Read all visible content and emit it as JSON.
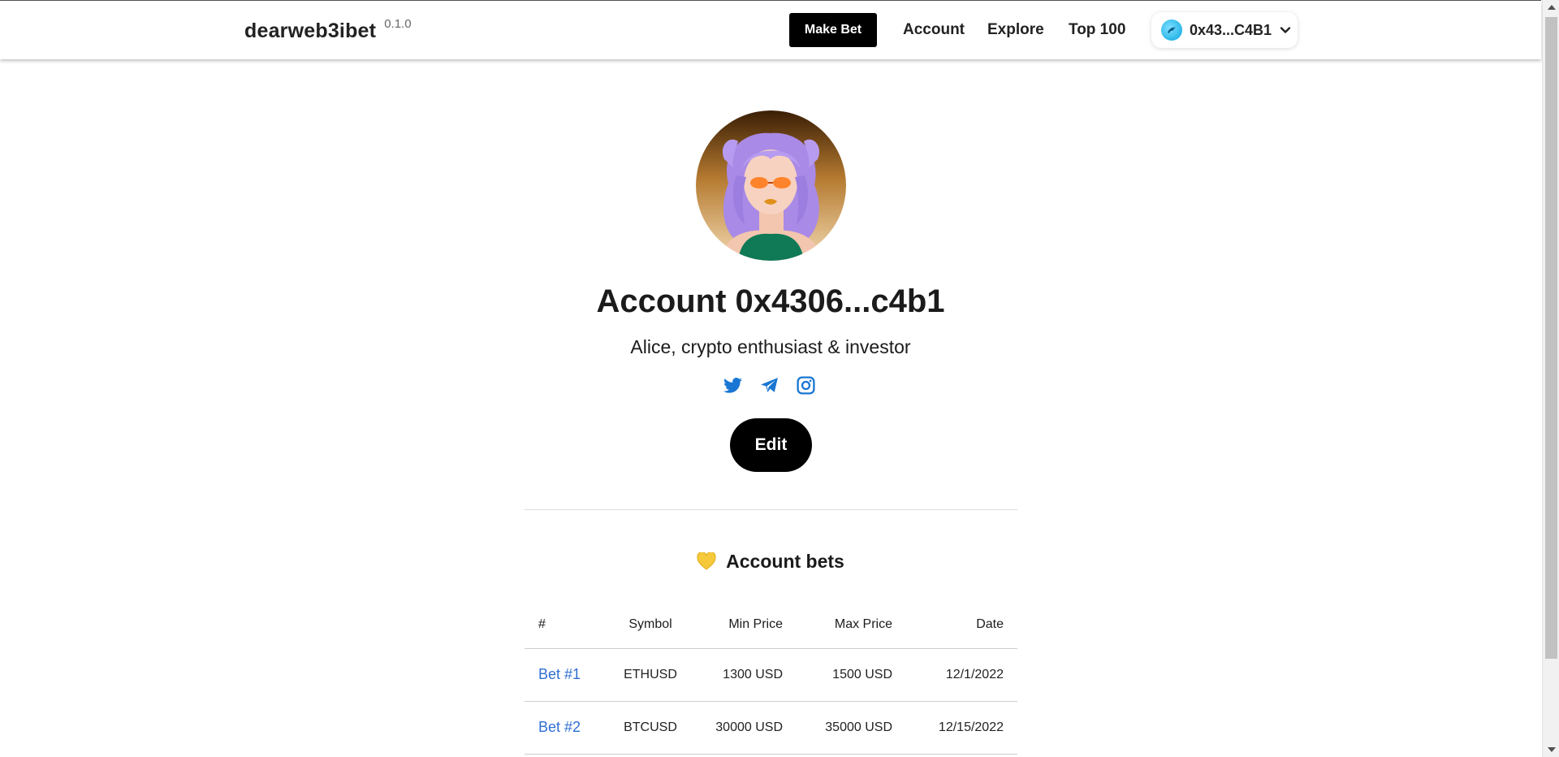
{
  "header": {
    "brand": "dearweb3ibet",
    "version": "0.1.0",
    "make_bet_label": "Make Bet",
    "nav": [
      {
        "label": "Account"
      },
      {
        "label": "Explore"
      },
      {
        "label": "Top 100"
      }
    ],
    "wallet": {
      "address": "0x43...C4B1",
      "avatar_icon": "dolphin-icon"
    }
  },
  "profile": {
    "title": "Account 0x4306...c4b1",
    "bio": "Alice, crypto enthusiast & investor",
    "socials": [
      "twitter-icon",
      "telegram-icon",
      "instagram-icon"
    ],
    "edit_label": "Edit"
  },
  "bets": {
    "heading_icon": "yellow-heart-icon",
    "heading": "Account bets",
    "columns": [
      "#",
      "Symbol",
      "Min Price",
      "Max Price",
      "Date"
    ],
    "rows": [
      {
        "id": "Bet #1",
        "symbol": "ETHUSD",
        "min": "1300 USD",
        "max": "1500 USD",
        "date": "12/1/2022"
      },
      {
        "id": "Bet #2",
        "symbol": "BTCUSD",
        "min": "30000 USD",
        "max": "35000 USD",
        "date": "12/15/2022"
      }
    ]
  },
  "colors": {
    "accent_link": "#2f6fd1",
    "button_bg": "#000000",
    "social_icon": "#1976d2"
  }
}
